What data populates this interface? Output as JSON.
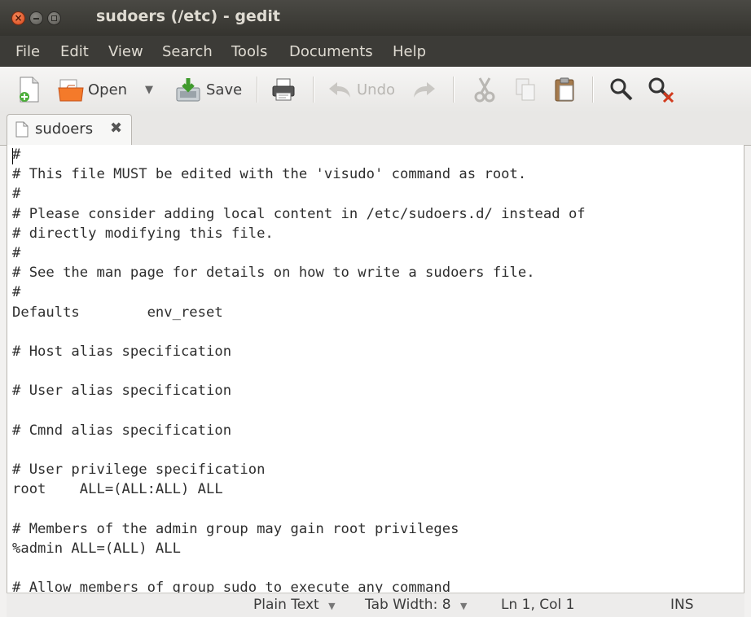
{
  "window": {
    "title": "sudoers (/etc) - gedit"
  },
  "menu": {
    "items": [
      "File",
      "Edit",
      "View",
      "Search",
      "Tools",
      "Documents",
      "Help"
    ]
  },
  "toolbar": {
    "open_label": "Open",
    "save_label": "Save",
    "undo_label": "Undo",
    "icons": [
      "new-document-icon",
      "open-folder-icon",
      "dropdown-arrow-icon",
      "save-icon",
      "print-icon",
      "undo-icon",
      "redo-icon",
      "cut-icon",
      "copy-icon",
      "paste-icon",
      "search-icon",
      "search-replace-icon"
    ]
  },
  "tabs": [
    {
      "label": "sudoers"
    }
  ],
  "editor": {
    "content": "#\n# This file MUST be edited with the 'visudo' command as root.\n#\n# Please consider adding local content in /etc/sudoers.d/ instead of\n# directly modifying this file.\n#\n# See the man page for details on how to write a sudoers file.\n#\nDefaults        env_reset\n\n# Host alias specification\n\n# User alias specification\n\n# Cmnd alias specification\n\n# User privilege specification\nroot    ALL=(ALL:ALL) ALL\n\n# Members of the admin group may gain root privileges\n%admin ALL=(ALL) ALL\n\n# Allow members of group sudo to execute any command"
  },
  "statusbar": {
    "language": "Plain Text",
    "tab_width": "Tab Width: 8",
    "position": "Ln 1, Col 1",
    "mode": "INS"
  }
}
